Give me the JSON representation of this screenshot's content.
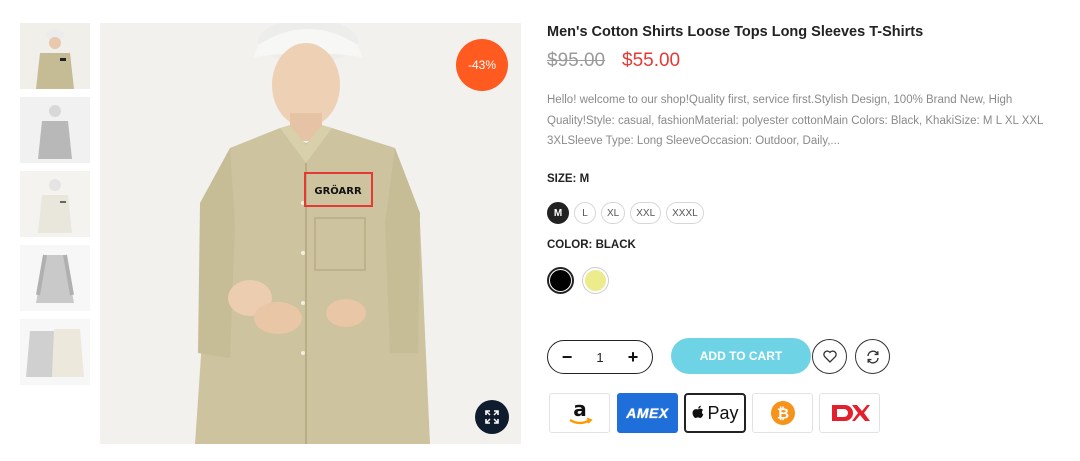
{
  "product": {
    "title": "Men's Cotton Shirts Loose Tops Long Sleeves T-Shirts",
    "old_price": "$95.00",
    "new_price": "$55.00",
    "discount_badge": "-43%",
    "description": "Hello! welcome to our shop!Quality first, service first.Stylish Design, 100% Brand New, High Quality!Style: casual, fashionMaterial: polyester cottonMain Colors: Black, KhakiSize: M L XL XXL 3XLSleeve Type: Long SleeveOccasion: Outdoor, Daily,...",
    "chest_logo": "GRÖARR"
  },
  "size": {
    "label": "SIZE:",
    "selected": "M",
    "options": [
      "M",
      "L",
      "XL",
      "XXL",
      "XXXL"
    ]
  },
  "color": {
    "label": "COLOR:",
    "selected": "BLACK",
    "options": [
      {
        "name": "black",
        "hex": "#000000"
      },
      {
        "name": "khaki",
        "hex": "#ecec8c"
      }
    ]
  },
  "cart": {
    "quantity": "1",
    "minus": "−",
    "plus": "+",
    "add_label": "ADD TO CART"
  },
  "icons": {
    "wishlist": "heart-icon",
    "compare": "refresh-icon",
    "zoom": "expand-icon"
  },
  "payments": {
    "amex_label": "AMEX",
    "applepay_label": "Pay"
  },
  "colors": {
    "accent_badge": "#ff5a1f",
    "price_red": "#e53935",
    "cart_button": "#6fd3e6"
  }
}
